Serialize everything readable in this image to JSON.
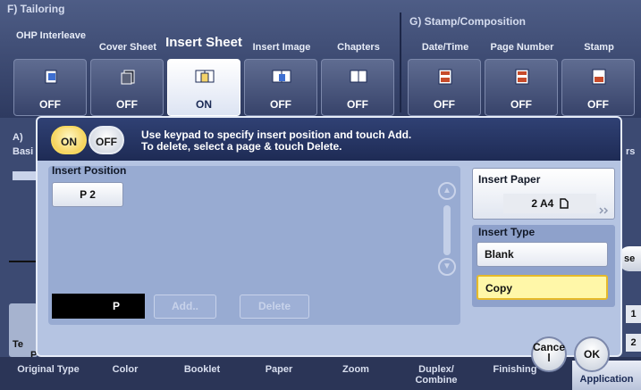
{
  "groups": {
    "tailoring": "F)  Tailoring",
    "stamp": "G)  Stamp/Composition",
    "left_fragment": "A)",
    "left_fragment2": "Basi",
    "right_fragment": "rs"
  },
  "tabs": [
    {
      "label": "OHP Interleave",
      "state": "OFF"
    },
    {
      "label": "Cover Sheet",
      "state": "OFF"
    },
    {
      "label": "Insert Sheet",
      "state": "ON"
    },
    {
      "label": "Insert Image",
      "state": "OFF"
    },
    {
      "label": "Chapters",
      "state": "OFF"
    },
    {
      "label": "Date/Time",
      "state": "OFF"
    },
    {
      "label": "Page Number",
      "state": "OFF"
    },
    {
      "label": "Stamp",
      "state": "OFF"
    }
  ],
  "bottom_tabs": [
    "Original Type",
    "Color",
    "Booklet",
    "Paper",
    "Zoom",
    "Duplex/ Combine",
    "Finishing",
    "Application"
  ],
  "side_fragments": {
    "te_text": "Te",
    "p_text": "P",
    "se_text": "se",
    "num1": "1",
    "num2": "2",
    "finishing_frag": "c"
  },
  "dialog": {
    "on_label": "ON",
    "off_label": "OFF",
    "instruction_line1": "Use keypad to specify insert position and touch Add.",
    "instruction_line2": "To delete, select a page & touch Delete.",
    "insert_position_label": "Insert Position",
    "page_item": "P  2",
    "input_value": "P",
    "add_label": "Add..",
    "delete_label": "Delete",
    "insert_paper_label": "Insert Paper",
    "insert_paper_value": "2  A4",
    "insert_type_label": "Insert Type",
    "type_options": [
      "Blank",
      "Copy"
    ],
    "selected_type": "Copy",
    "cancel_label": "Cance l",
    "ok_label": "OK"
  }
}
